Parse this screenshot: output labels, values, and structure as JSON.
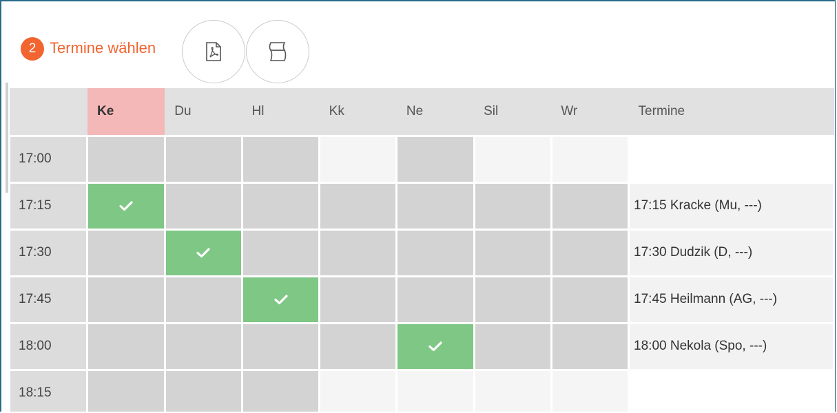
{
  "step": {
    "number": "2",
    "title": "Termine wählen"
  },
  "toolbar": {
    "pdf_icon": "pdf-icon",
    "sheet_icon": "sheet-icon"
  },
  "colors": {
    "accent": "#f26430",
    "selected_column": "#f5b8b8",
    "booked": "#7fc785",
    "busy": "#d3d3d3"
  },
  "columns": [
    "Ke",
    "Du",
    "Hl",
    "Kk",
    "Ne",
    "Sil",
    "Wr"
  ],
  "selected_column": "Ke",
  "appointments_header": "Termine",
  "rows": [
    {
      "time": "17:00",
      "appointment": ""
    },
    {
      "time": "17:15",
      "appointment": "17:15 Kracke (Mu, ---)"
    },
    {
      "time": "17:30",
      "appointment": "17:30 Dudzik (D, ---)"
    },
    {
      "time": "17:45",
      "appointment": "17:45 Heilmann (AG, ---)"
    },
    {
      "time": "18:00",
      "appointment": "18:00 Nekola (Spo, ---)"
    },
    {
      "time": "18:15",
      "appointment": ""
    }
  ],
  "slot_states": [
    [
      "busy",
      "busy",
      "busy",
      "free",
      "busy",
      "free",
      "free"
    ],
    [
      "booked",
      "busy",
      "busy",
      "busy",
      "busy",
      "busy",
      "busy"
    ],
    [
      "busy",
      "booked",
      "busy",
      "busy",
      "busy",
      "busy",
      "busy"
    ],
    [
      "busy",
      "busy",
      "booked",
      "busy",
      "busy",
      "busy",
      "busy"
    ],
    [
      "busy",
      "busy",
      "busy",
      "busy",
      "booked",
      "busy",
      "busy"
    ],
    [
      "busy",
      "busy",
      "busy",
      "free",
      "free",
      "free",
      "free"
    ]
  ]
}
